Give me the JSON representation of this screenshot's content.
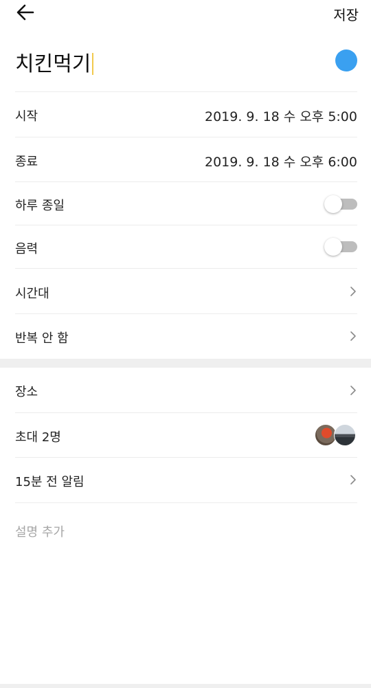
{
  "header": {
    "back_icon": "arrow-left-icon",
    "save_label": "저장"
  },
  "event": {
    "title": "치킨먹기",
    "color": "#3aa0f0"
  },
  "start": {
    "label": "시작",
    "value": "2019. 9. 18 수   오후 5:00"
  },
  "end": {
    "label": "종료",
    "value": "2019. 9. 18 수   오후 6:00"
  },
  "all_day": {
    "label": "하루 종일",
    "enabled": false
  },
  "lunar": {
    "label": "음력",
    "enabled": false
  },
  "timezone": {
    "label": "시간대"
  },
  "repeat": {
    "label": "반복 안 함"
  },
  "location": {
    "label": "장소"
  },
  "invite": {
    "label": "초대 2명"
  },
  "alarm": {
    "label": "15분 전 알림"
  },
  "description": {
    "placeholder": "설명 추가"
  }
}
